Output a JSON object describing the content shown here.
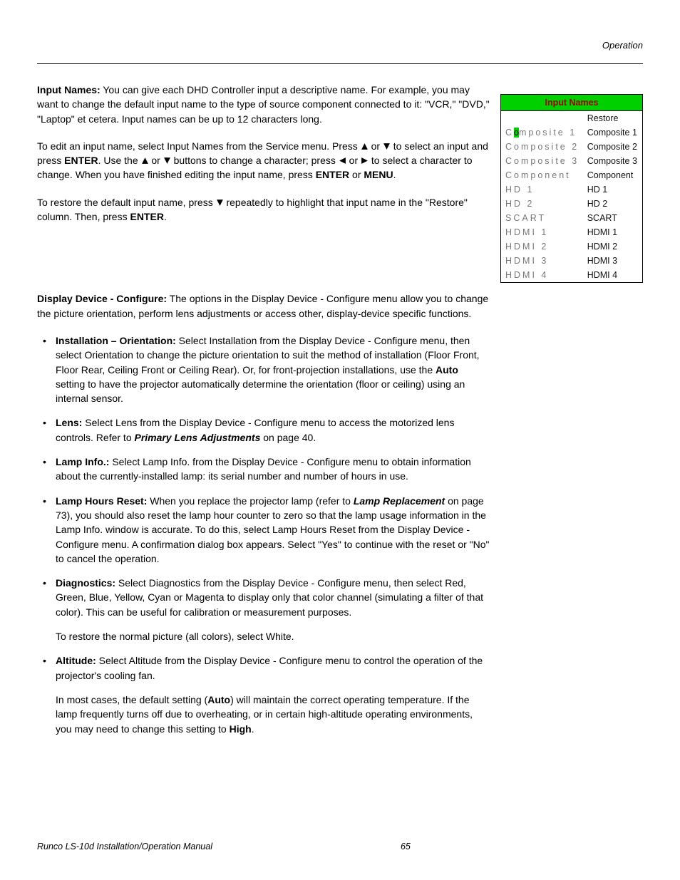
{
  "header": {
    "section": "Operation"
  },
  "input_names": {
    "heading": "Input Names:",
    "p1_a": " You can give each DHD Controller input a descriptive name. For example, you may want to change the default input name to the type of source component connected to it: \"VCR,\" \"DVD,\" \"Laptop\" et cetera. Input names can be up to 12 characters long.",
    "p2_a": "To edit an input name, select Input Names from the Service menu. Press ",
    "p2_b": " or ",
    "p2_c": " to select an input and press ",
    "enter": "ENTER",
    "p2_d": ". Use the ",
    "p2_e": " or ",
    "p2_f": " buttons to change a character; press ",
    "p2_g": " or ",
    "p2_h": " to select a character to change. When you have finished editing the input name, press ",
    "p2_i": " or ",
    "menu": "MENU",
    "p2_j": ".",
    "p3_a": "To restore the default input name, press ",
    "p3_b": " repeatedly to highlight that input name in the \"Restore\" column. Then, press ",
    "p3_c": "."
  },
  "table": {
    "title": "Input Names",
    "restore_header": "Restore",
    "cursor_pre": "C",
    "cursor_char": "o",
    "cursor_post": "mposite 1",
    "rows": [
      {
        "edit": "Composite 2",
        "restore": "Composite 2"
      },
      {
        "edit": "Composite 3",
        "restore": "Composite 3"
      },
      {
        "edit": "Component",
        "restore": "Component"
      },
      {
        "edit": "HD 1",
        "restore": "HD 1"
      },
      {
        "edit": "HD 2",
        "restore": "HD 2"
      },
      {
        "edit": "SCART",
        "restore": "SCART"
      },
      {
        "edit": "HDMI 1",
        "restore": "HDMI 1"
      },
      {
        "edit": "HDMI 2",
        "restore": "HDMI 2"
      },
      {
        "edit": "HDMI 3",
        "restore": "HDMI 3"
      },
      {
        "edit": "HDMI 4",
        "restore": "HDMI 4"
      }
    ],
    "row0_restore": "Composite 1"
  },
  "display_device": {
    "heading": "Display Device - Configure:",
    "intro": " The options in the Display Device - Configure menu allow you to change the picture orientation, perform lens adjustments or access other, display-device specific functions.",
    "orientation_h": "Installation – Orientation:",
    "orientation_t": " Select Installation from the Display Device - Configure menu, then select Orientation to change the picture orientation to suit the method of installation (Floor Front, Floor Rear, Ceiling Front or Ceiling Rear). Or, for front-projection installations, use the ",
    "auto": "Auto",
    "orientation_t2": " setting to have the projector automatically determine the orientation (floor or ceiling) using an internal sensor.",
    "lens_h": "Lens:",
    "lens_t1": " Select Lens from the Display Device - Configure menu to access the motorized lens controls. Refer to ",
    "lens_ref": "Primary Lens Adjustments",
    "lens_t2": " on page 40.",
    "lamp_info_h": "Lamp Info.:",
    "lamp_info_t": " Select Lamp Info. from the Display Device - Configure menu to obtain information about the currently-installed lamp: its serial number and number of hours in use.",
    "lamp_hours_h": "Lamp Hours Reset:",
    "lamp_hours_t1": " When you replace the projector lamp (refer to ",
    "lamp_ref": "Lamp Replacement",
    "lamp_hours_t2": " on page 73), you should also reset the lamp hour counter to zero so that the lamp usage information in the Lamp Info. window is accurate. To do this, select Lamp Hours Reset from the Display Device - Configure menu. A confirmation dialog box appears. Select \"Yes\" to continue with the reset or \"No\" to cancel the operation.",
    "diag_h": "Diagnostics:",
    "diag_t": " Select Diagnostics from the Display Device - Configure menu, then select Red, Green, Blue, Yellow, Cyan or Magenta to display only that color channel (simulating a filter of that color). This can be useful for calibration or measurement purposes.",
    "diag_p2": "To restore the normal picture (all colors), select White.",
    "alt_h": "Altitude:",
    "alt_t": " Select Altitude from the Display Device - Configure menu to control the operation of the projector's cooling fan.",
    "alt_p2_a": "In most cases, the default setting (",
    "alt_p2_b": ") will maintain the correct operating temperature. If the lamp frequently turns off due to overheating, or in certain high-altitude operating environments, you may need to change this setting to ",
    "high": "High",
    "alt_p2_c": "."
  },
  "footer": {
    "title": "Runco LS-10d Installation/Operation Manual",
    "page": "65"
  }
}
